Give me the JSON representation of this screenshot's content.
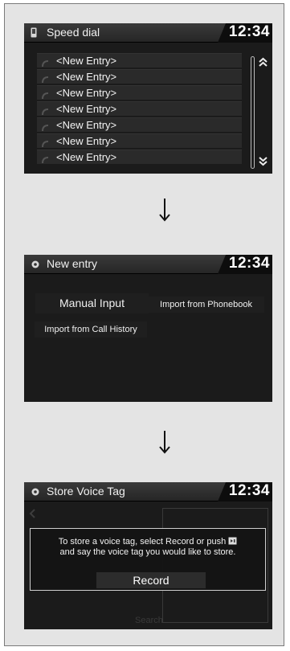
{
  "screens": [
    {
      "title": "Speed dial",
      "clock": "12:34",
      "entries": [
        "<New Entry>",
        "<New Entry>",
        "<New Entry>",
        "<New Entry>",
        "<New Entry>",
        "<New Entry>",
        "<New Entry>"
      ],
      "icons": {
        "title": "phone-icon",
        "row": "handset-icon",
        "scroll_up": "double-chevron-up-icon",
        "scroll_down": "double-chevron-down-icon"
      }
    },
    {
      "title": "New entry",
      "clock": "12:34",
      "options": {
        "manual": "Manual Input",
        "phonebook": "Import from Phonebook",
        "history": "Import from Call History"
      },
      "icons": {
        "title": "gear-icon"
      }
    },
    {
      "title": "Store Voice Tag",
      "clock": "12:34",
      "dialog_line1": "To store a voice tag, select Record or push",
      "dialog_line2": "and say the voice tag you would like to store.",
      "record_label": "Record",
      "background_label": "Search",
      "icons": {
        "title": "gear-icon",
        "talk": "talk-button-icon",
        "back": "back-chevron-icon"
      }
    }
  ],
  "arrows": [
    "down-arrow-icon",
    "down-arrow-icon"
  ],
  "colors": {
    "screen_bg": "#1b1b1b",
    "title_text": "#f0f0f0",
    "frame_bg": "#e4e4e4"
  }
}
